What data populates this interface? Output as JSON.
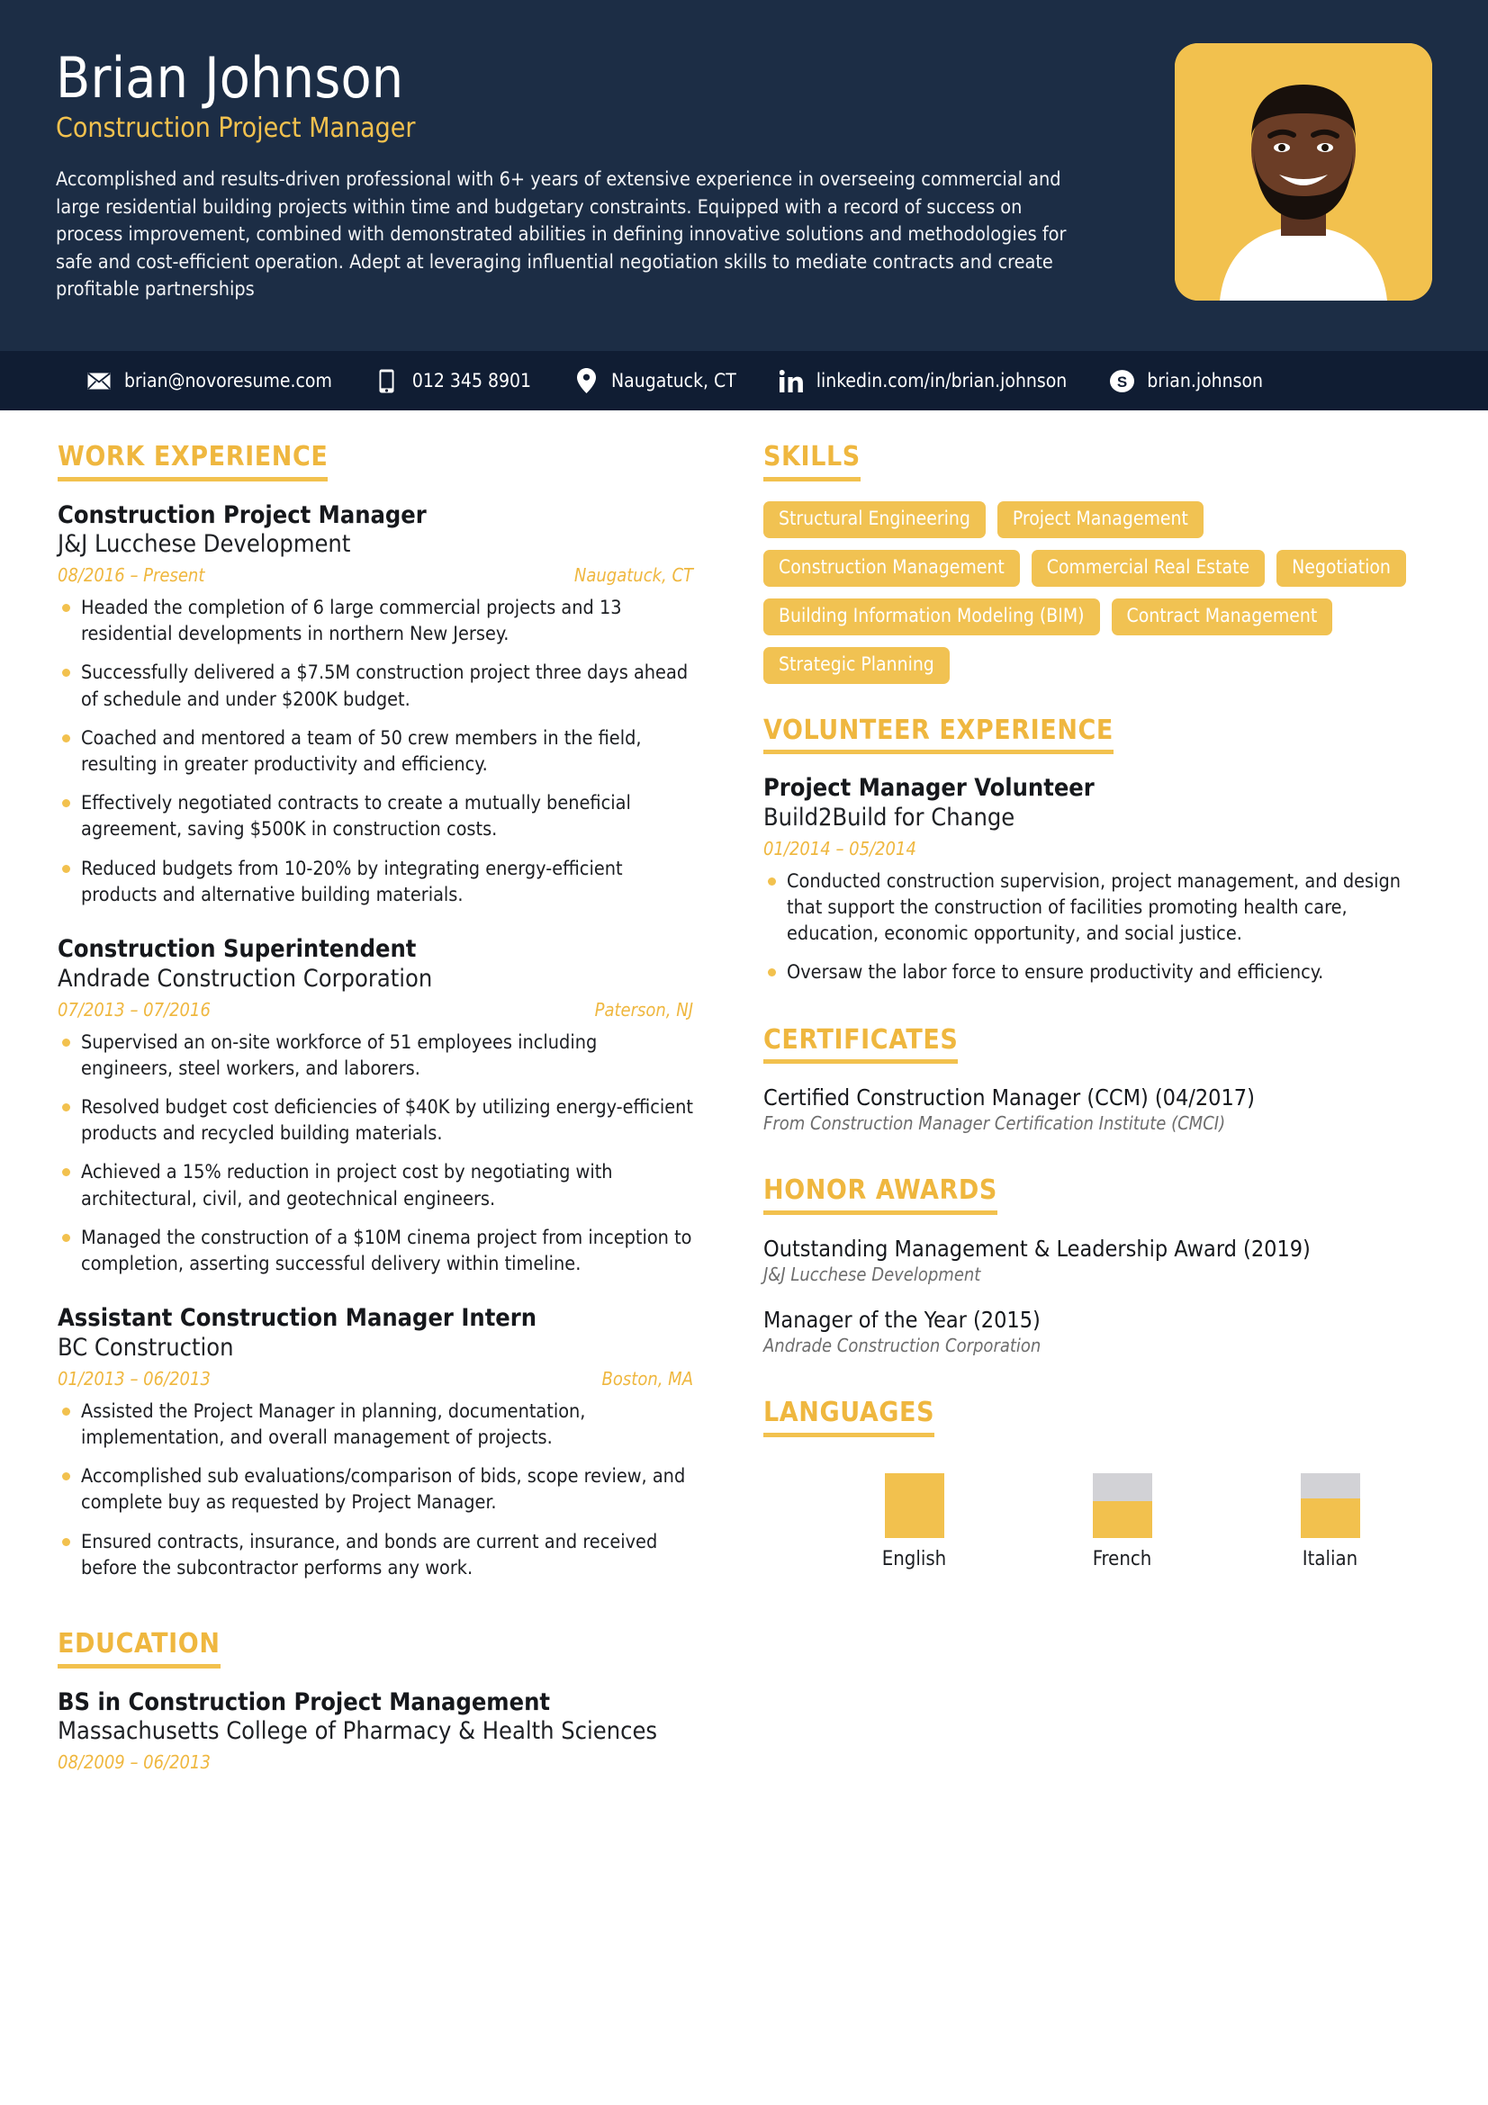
{
  "colors": {
    "navy": "#1c2d45",
    "navy_bar": "#101d33",
    "accent": "#f2c14e",
    "chip": "#f1c252",
    "grey_bar": "#d2d2d6"
  },
  "header": {
    "name": "Brian Johnson",
    "job_title": "Construction Project Manager",
    "summary": "Accomplished and results-driven professional with 6+ years of extensive experience in overseeing commercial and large residential building projects within time and budgetary constraints. Equipped with a record of success on process improvement, combined with demonstrated abilities in defining innovative solutions and methodologies for safe and cost-efficient operation. Adept at leveraging influential negotiation skills to mediate contracts and create profitable partnerships",
    "photo_alt": "profile-photo"
  },
  "contact": [
    {
      "icon": "email-icon",
      "text": "brian@novoresume.com"
    },
    {
      "icon": "phone-icon",
      "text": "012 345 8901"
    },
    {
      "icon": "location-icon",
      "text": "Naugatuck, CT"
    },
    {
      "icon": "linkedin-icon",
      "text": "linkedin.com/in/brian.johnson"
    },
    {
      "icon": "skype-icon",
      "text": "brian.johnson"
    }
  ],
  "work_experience": {
    "heading": "WORK EXPERIENCE",
    "entries": [
      {
        "title": "Construction Project Manager",
        "org": "J&J Lucchese Development",
        "date": "08/2016 – Present",
        "location": "Naugatuck, CT",
        "bullets": [
          "Headed the completion of 6 large commercial projects and 13 residential developments in northern New Jersey.",
          "Successfully delivered a $7.5M construction project three days ahead of schedule and under $200K budget.",
          "Coached and mentored a team of 50 crew members in the field, resulting in greater productivity and efficiency.",
          "Effectively negotiated contracts to create a mutually beneficial agreement, saving $500K in construction costs.",
          "Reduced budgets from 10-20% by integrating energy-efficient products and alternative building materials."
        ]
      },
      {
        "title": "Construction Superintendent",
        "org": "Andrade Construction Corporation",
        "date": "07/2013 – 07/2016",
        "location": "Paterson, NJ",
        "bullets": [
          "Supervised an on-site workforce of 51 employees including engineers, steel workers, and laborers.",
          "Resolved budget cost deficiencies of $40K by utilizing energy-efficient products and recycled building materials.",
          "Achieved a 15% reduction in project cost by negotiating with architectural, civil, and geotechnical engineers.",
          "Managed the construction of a $10M cinema project from inception to completion, asserting successful delivery within timeline."
        ]
      },
      {
        "title": "Assistant Construction Manager Intern",
        "org": "BC Construction",
        "date": "01/2013 – 06/2013",
        "location": "Boston, MA",
        "bullets": [
          "Assisted the Project Manager in planning, documentation, implementation, and overall management of projects.",
          "Accomplished sub evaluations/comparison of bids, scope review, and complete buy as requested by Project Manager.",
          "Ensured contracts, insurance, and bonds are current and received before the subcontractor performs any work."
        ]
      }
    ]
  },
  "education": {
    "heading": "EDUCATION",
    "entries": [
      {
        "title": "BS in Construction Project Management",
        "org": "Massachusetts College of Pharmacy & Health Sciences",
        "date": "08/2009 – 06/2013",
        "location": ""
      }
    ]
  },
  "skills": {
    "heading": "SKILLS",
    "items": [
      "Structural Engineering",
      "Project Management",
      "Construction Management",
      "Commercial Real Estate",
      "Negotiation",
      "Building Information Modeling (BIM)",
      "Contract Management",
      "Strategic Planning"
    ]
  },
  "volunteer": {
    "heading": "VOLUNTEER EXPERIENCE",
    "entries": [
      {
        "title": "Project Manager Volunteer",
        "org": "Build2Build for Change",
        "date": "01/2014 – 05/2014",
        "location": "",
        "bullets": [
          "Conducted construction supervision, project management, and design that support the construction of facilities promoting health care, education, economic opportunity, and social justice.",
          "Oversaw the labor force to ensure productivity and efficiency."
        ]
      }
    ]
  },
  "certificates": {
    "heading": "CERTIFICATES",
    "items": [
      {
        "title": "Certified Construction Manager (CCM) (04/2017)",
        "sub": "From Construction Manager Certification Institute (CMCI)"
      }
    ]
  },
  "honor_awards": {
    "heading": "HONOR AWARDS",
    "items": [
      {
        "title": "Outstanding Management & Leadership Award (2019)",
        "sub": "J&J Lucchese Development"
      },
      {
        "title": "Manager of the Year (2015)",
        "sub": "Andrade Construction Corporation"
      }
    ]
  },
  "languages": {
    "heading": "LANGUAGES",
    "items": [
      {
        "name": "English",
        "level_percent": 100
      },
      {
        "name": "French",
        "level_percent": 57
      },
      {
        "name": "Italian",
        "level_percent": 61
      }
    ]
  }
}
